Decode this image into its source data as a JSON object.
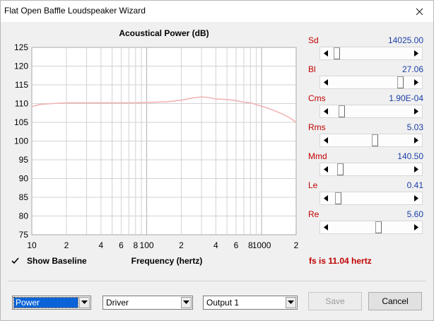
{
  "window": {
    "title": "Flat Open Baffle Loudspeaker Wizard"
  },
  "chart_title": "Acoustical Power (dB)",
  "x_axis_label": "Frequency (hertz)",
  "show_baseline_label": "Show Baseline",
  "show_baseline_checked": true,
  "fs_text": "fs is 11.04 hertz",
  "params": [
    {
      "label": "Sd",
      "value": "14025.00",
      "level": 0.03
    },
    {
      "label": "Bl",
      "value": "27.06",
      "level": 0.9
    },
    {
      "label": "Cms",
      "value": "1.90E-04",
      "level": 0.1
    },
    {
      "label": "Rms",
      "value": "5.03",
      "level": 0.55
    },
    {
      "label": "Mmd",
      "value": "140.50",
      "level": 0.08
    },
    {
      "label": "Le",
      "value": "0.41",
      "level": 0.05
    },
    {
      "label": "Re",
      "value": "5.60",
      "level": 0.6
    }
  ],
  "controls": {
    "combo1": "Power",
    "combo2": "Driver",
    "combo3": "Output 1",
    "save": "Save",
    "cancel": "Cancel"
  },
  "colors": {
    "curve": "#f2b4b4",
    "param_label": "#c00000",
    "param_value": "#1a3fa6"
  },
  "chart_data": {
    "type": "line",
    "title": "Acoustical Power (dB)",
    "xlabel": "Frequency (hertz)",
    "ylabel": "",
    "x_scale": "log",
    "xlim": [
      10,
      2000
    ],
    "ylim": [
      75,
      125
    ],
    "y_ticks": [
      75,
      80,
      85,
      90,
      95,
      100,
      105,
      110,
      115,
      120,
      125
    ],
    "x_ticks": [
      {
        "value": 10,
        "label": "10"
      },
      {
        "value": 20,
        "label": "2"
      },
      {
        "value": 40,
        "label": "4"
      },
      {
        "value": 60,
        "label": "6"
      },
      {
        "value": 80,
        "label": "8"
      },
      {
        "value": 100,
        "label": "100"
      },
      {
        "value": 200,
        "label": "2"
      },
      {
        "value": 400,
        "label": "4"
      },
      {
        "value": 600,
        "label": "6"
      },
      {
        "value": 800,
        "label": "8"
      },
      {
        "value": 1000,
        "label": "1000"
      },
      {
        "value": 2000,
        "label": "2"
      }
    ],
    "grid": true,
    "series": [
      {
        "x": [
          10,
          12,
          15,
          20,
          30,
          50,
          80,
          100,
          150,
          200,
          250,
          300,
          350,
          400,
          500,
          600,
          700,
          800,
          1000,
          1200,
          1500,
          1800,
          2000
        ],
        "values": [
          109.2,
          109.8,
          110.0,
          110.2,
          110.2,
          110.2,
          110.2,
          110.3,
          110.5,
          110.9,
          111.5,
          111.8,
          111.6,
          111.2,
          111.1,
          110.8,
          110.4,
          110.2,
          109.3,
          108.5,
          107.3,
          106.0,
          105.0
        ]
      }
    ]
  }
}
